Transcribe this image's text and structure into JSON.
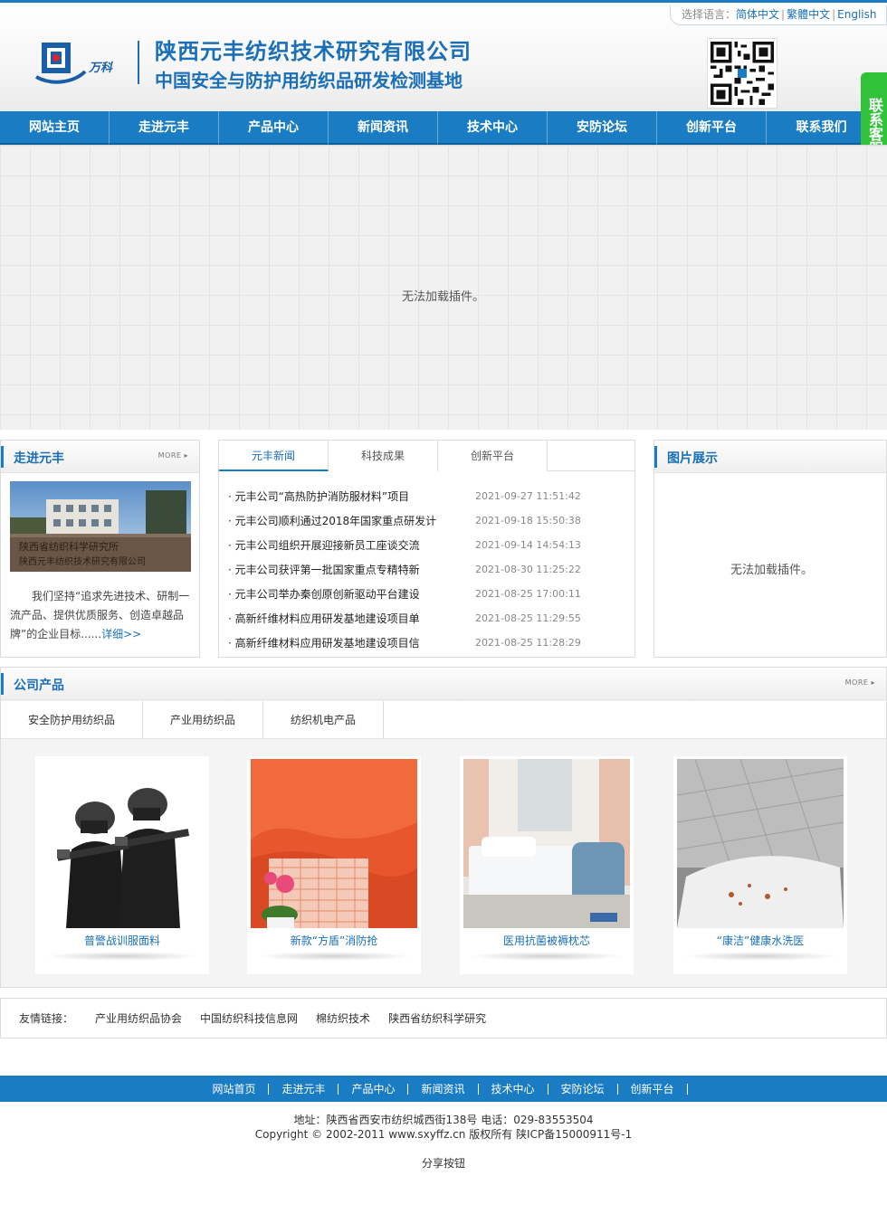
{
  "language": {
    "label": "选择语言：",
    "options": [
      "简体中文",
      "繁體中文",
      "English"
    ]
  },
  "header": {
    "logo_text": "万科",
    "company_name": "陕西元丰纺织技术研究有限公司",
    "slogan": "中国安全与防护用纺织品研发检测基地",
    "qr_icon": "qr-code"
  },
  "nav": [
    "网站主页",
    "走进元丰",
    "产品中心",
    "新闻资讯",
    "技术中心",
    "安防论坛",
    "创新平台",
    "联系我们"
  ],
  "side_contact": "联系客服",
  "banner": {
    "message": "无法加载插件。"
  },
  "about": {
    "title": "走进元丰",
    "more": "MORE",
    "text": "我们坚持“追求先进技术、研制一流产品、提供优质服务、创造卓越品牌”的企业目标......",
    "detail_link": "详细>>",
    "gate_sign_line1": "陕西省纺织科学研究所",
    "gate_sign_line2": "陕西元丰纺织技术研究有限公司"
  },
  "news": {
    "tabs": [
      "元丰新闻",
      "科技成果",
      "创新平台"
    ],
    "items": [
      {
        "title": "· 元丰公司“高热防护消防服材料”项目",
        "date": "2021-09-27 11:51:42"
      },
      {
        "title": "· 元丰公司顺利通过2018年国家重点研发计",
        "date": "2021-09-18 15:50:38"
      },
      {
        "title": "· 元丰公司组织开展迎接新员工座谈交流",
        "date": "2021-09-14 14:54:13"
      },
      {
        "title": "· 元丰公司获评第一批国家重点专精特新",
        "date": "2021-08-30 11:25:22"
      },
      {
        "title": "· 元丰公司举办秦创原创新驱动平台建设",
        "date": "2021-08-25 17:00:11"
      },
      {
        "title": "· 高新纤维材料应用研发基地建设项目单",
        "date": "2021-08-25 11:29:55"
      },
      {
        "title": "· 高新纤维材料应用研发基地建设项目信",
        "date": "2021-08-25 11:28:29"
      }
    ]
  },
  "gallery": {
    "title": "图片展示",
    "message": "无法加载插件。"
  },
  "products": {
    "title": "公司产品",
    "more": "MORE",
    "tabs": [
      "安全防护用纺织品",
      "产业用纺织品",
      "纺织机电产品"
    ],
    "items": [
      {
        "name": "普警战训服面料"
      },
      {
        "name": "新款“方盾”消防抢"
      },
      {
        "name": "医用抗菌被褥枕芯"
      },
      {
        "name": "“康洁”健康水洗医"
      }
    ]
  },
  "links": {
    "label": "友情链接：",
    "items": [
      "产业用纺织品协会",
      "中国纺织科技信息网",
      "棉纺织技术",
      "陕西省纺织科学研究"
    ]
  },
  "footer": {
    "nav": [
      "网站首页",
      "走进元丰",
      "产品中心",
      "新闻资讯",
      "技术中心",
      "安防论坛",
      "创新平台"
    ],
    "address": "地址：陕西省西安市纺织城西街138号 电话：029-83553504",
    "copyright": "Copyright © 2002-2011 www.sxyffz.cn 版权所有 陕ICP备15000911号-1",
    "share": "分享按钮"
  }
}
